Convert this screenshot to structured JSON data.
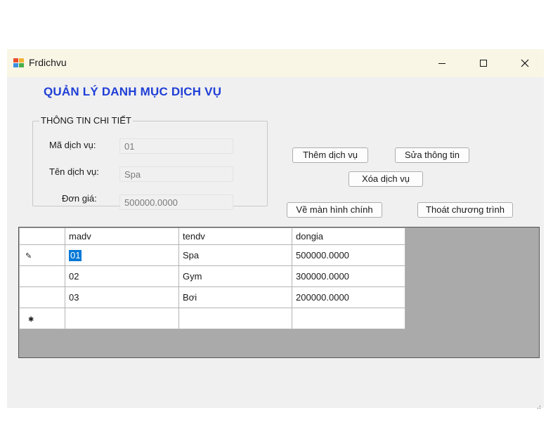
{
  "window": {
    "title": "Frdichvu",
    "controls": {
      "minimize": "minimize-icon",
      "maximize": "maximize-icon",
      "close": "close-icon"
    }
  },
  "heading": "QUẢN LÝ DANH MỤC DỊCH VỤ",
  "details": {
    "legend": "THÔNG TIN CHI TIẾT",
    "madv_label": "Mã dịch vụ:",
    "madv_value": "01",
    "tendv_label": "Tên dịch vụ:",
    "tendv_value": "Spa",
    "dongia_label": "Đơn giá:",
    "dongia_value": "500000.0000"
  },
  "buttons": {
    "add": "Thêm dịch vụ",
    "edit": "Sửa thông tin",
    "delete": "Xóa dịch vụ",
    "home": "Về màn hình chính",
    "exit": "Thoát chương trình"
  },
  "grid": {
    "columns": [
      "madv",
      "tendv",
      "dongia"
    ],
    "rows": [
      [
        "01",
        "Spa",
        "500000.0000"
      ],
      [
        "02",
        "Gym",
        "300000.0000"
      ],
      [
        "03",
        "Bơi",
        "200000.0000"
      ]
    ],
    "selected_cell": "01",
    "accent_color": "#0078d7"
  }
}
